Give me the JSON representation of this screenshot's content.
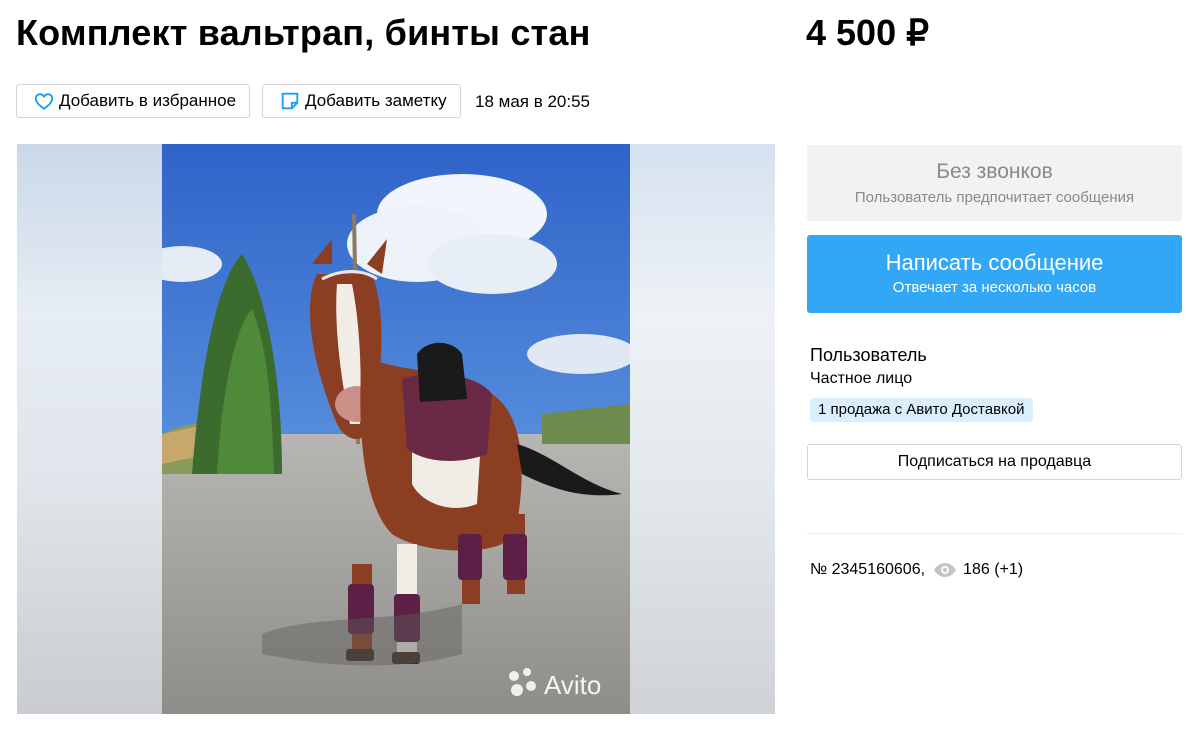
{
  "listing": {
    "title": "Комплект вальтрап, бинты стан",
    "price": "4 500 ₽",
    "date": "18 мая в 20:55",
    "id_text": "№ 2345160606,",
    "views": "186 (+1)"
  },
  "actions": {
    "favorite_label": "Добавить в избранное",
    "note_label": "Добавить заметку"
  },
  "contact": {
    "no_calls_title": "Без звонков",
    "no_calls_subtitle": "Пользователь предпочитает сообщения",
    "message_label": "Написать сообщение",
    "message_subtitle": "Отвечает за несколько часов"
  },
  "seller": {
    "name": "Пользователь",
    "type": "Частное лицо",
    "badge": "1 продажа с Авито Доставкой",
    "subscribe_label": "Подписаться на продавца"
  },
  "gallery": {
    "watermark": "Avito"
  },
  "icons": {
    "favorite": "heart-icon",
    "note": "note-icon",
    "views": "eye-icon"
  },
  "colors": {
    "accent_blue": "#31a7f5",
    "badge_bg": "#dbeefc",
    "muted_text": "#8a8a8a"
  }
}
